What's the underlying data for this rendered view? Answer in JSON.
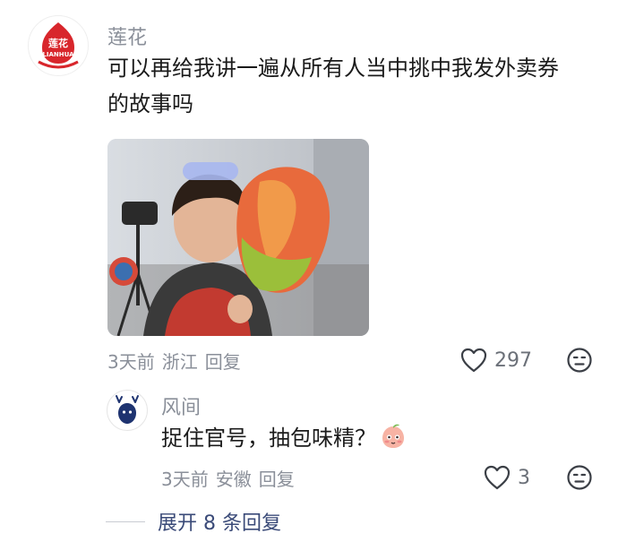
{
  "comment": {
    "username": "莲花",
    "avatar_text": "莲花",
    "avatar_subtext": "LIANHUA",
    "text_line1": "可以再给我讲一遍从所有人当中挑中我发外卖券",
    "text_line2": "的故事吗",
    "time": "3天前",
    "location": "浙江",
    "reply_label": "回复",
    "like_count": "297"
  },
  "reply": {
    "username": "风间",
    "text": "捉住官号，抽包味精？",
    "time": "3天前",
    "location": "安徽",
    "reply_label": "回复",
    "like_count": "3"
  },
  "expand": {
    "label": "展开 8 条回复"
  },
  "icons": {
    "like": "heart-outline-icon",
    "dislike": "unhappy-face-icon",
    "emoji": "blushing-peach-emoji"
  },
  "colors": {
    "brand_red": "#d8262c",
    "meta_gray": "#8a8f99",
    "expand_blue": "#3a4a78"
  }
}
